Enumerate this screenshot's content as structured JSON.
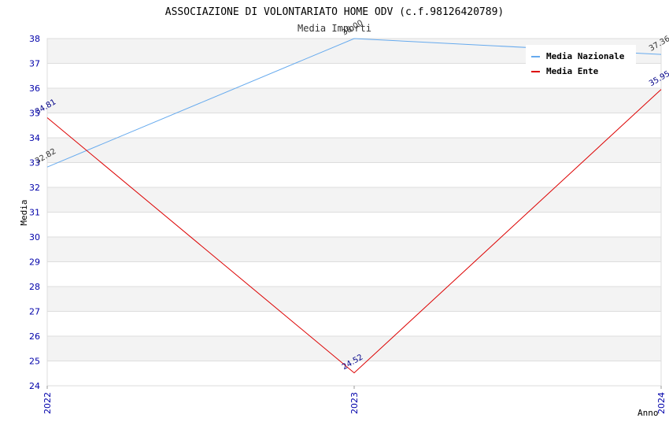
{
  "chart_data": {
    "type": "line",
    "title": "ASSOCIAZIONE DI VOLONTARIATO HOME ODV (c.f.98126420789)",
    "subtitle": "Media Importi",
    "xlabel": "Anno",
    "ylabel": "Media",
    "categories": [
      "2022",
      "2023",
      "2024"
    ],
    "ylim": [
      24,
      38
    ],
    "yticks": [
      "24",
      "25",
      "26",
      "27",
      "28",
      "29",
      "30",
      "31",
      "32",
      "33",
      "34",
      "35",
      "36",
      "37",
      "38"
    ],
    "grid": true,
    "legend_position": "top-right",
    "series": [
      {
        "name": "Media Nazionale",
        "color": "#66aaee",
        "label_color": "#333333",
        "values": [
          32.82,
          38.0,
          37.36
        ],
        "labels": [
          "32.82",
          "38.00",
          "37.36"
        ]
      },
      {
        "name": "Media Ente",
        "color": "#dd0000",
        "label_color": "#000088",
        "values": [
          34.81,
          24.52,
          35.95
        ],
        "labels": [
          "34.81",
          "24.52",
          "35.95"
        ]
      }
    ]
  }
}
